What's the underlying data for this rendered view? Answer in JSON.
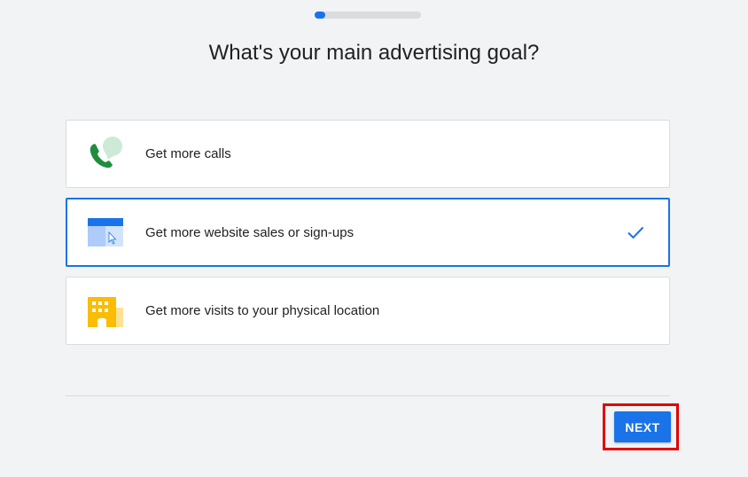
{
  "progress": {
    "fraction": 0.1,
    "fill_color": "#1a73e8",
    "track_color": "#dadce0"
  },
  "page": {
    "title": "What's your main advertising goal?"
  },
  "options": [
    {
      "label": "Get more calls",
      "icon": "phone-call-icon",
      "selected": false
    },
    {
      "label": "Get more website sales or sign-ups",
      "icon": "website-cursor-icon",
      "selected": true
    },
    {
      "label": "Get more visits to your physical location",
      "icon": "storefront-building-icon",
      "selected": false
    }
  ],
  "footer": {
    "next_label": "NEXT"
  },
  "colors": {
    "accent": "#1a73e8",
    "highlight": "#e00000",
    "background": "#f1f3f4"
  }
}
